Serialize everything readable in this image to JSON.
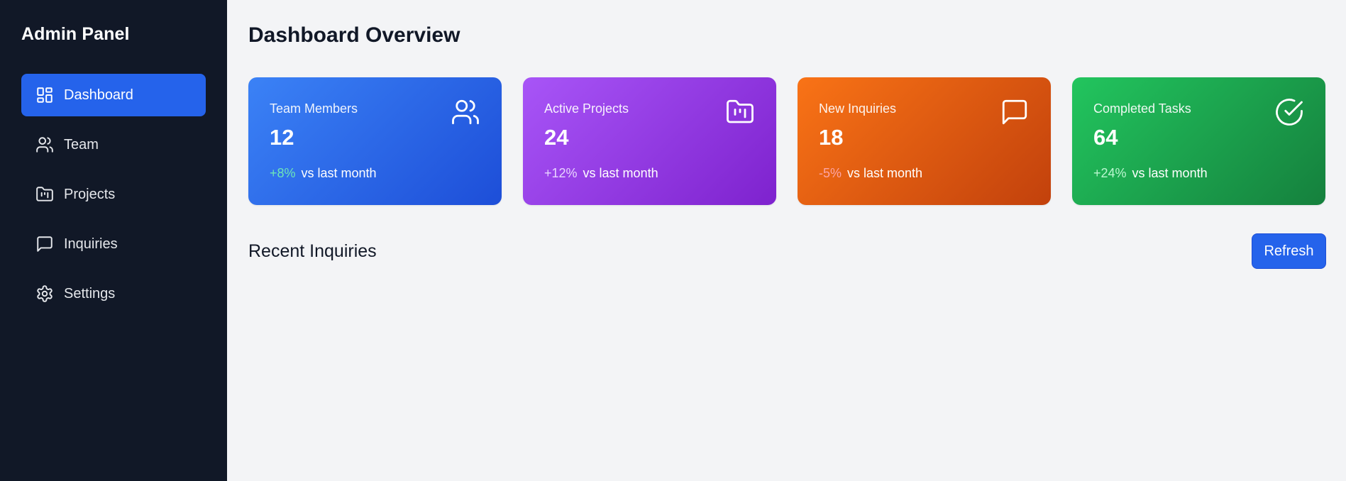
{
  "sidebar": {
    "title": "Admin Panel",
    "items": [
      {
        "label": "Dashboard",
        "icon": "dashboard-icon",
        "active": true
      },
      {
        "label": "Team",
        "icon": "users-icon",
        "active": false
      },
      {
        "label": "Projects",
        "icon": "folder-kanban-icon",
        "active": false
      },
      {
        "label": "Inquiries",
        "icon": "message-square-icon",
        "active": false
      },
      {
        "label": "Settings",
        "icon": "gear-icon",
        "active": false
      }
    ]
  },
  "main": {
    "title": "Dashboard Overview",
    "stats": [
      {
        "label": "Team Members",
        "value": "12",
        "change": "+8%",
        "change_color": "#6ee7b7",
        "suffix": "vs last month",
        "icon": "users-icon",
        "color": "#3b82f6"
      },
      {
        "label": "Active Projects",
        "value": "24",
        "change": "+12%",
        "change_color": "#e9d5ff",
        "suffix": "vs last month",
        "icon": "folder-kanban-icon",
        "color": "#a855f7"
      },
      {
        "label": "New Inquiries",
        "value": "18",
        "change": "-5%",
        "change_color": "#fca5a5",
        "suffix": "vs last month",
        "icon": "message-square-icon",
        "color": "#f97316"
      },
      {
        "label": "Completed Tasks",
        "value": "64",
        "change": "+24%",
        "change_color": "#bbf7d0",
        "suffix": "vs last month",
        "icon": "check-circle-icon",
        "color": "#22c55e"
      }
    ],
    "section": {
      "title": "Recent Inquiries",
      "refresh_label": "Refresh"
    }
  },
  "colors": {
    "sidebar_bg": "#111827",
    "accent": "#2563eb",
    "page_bg": "#f3f4f6"
  }
}
